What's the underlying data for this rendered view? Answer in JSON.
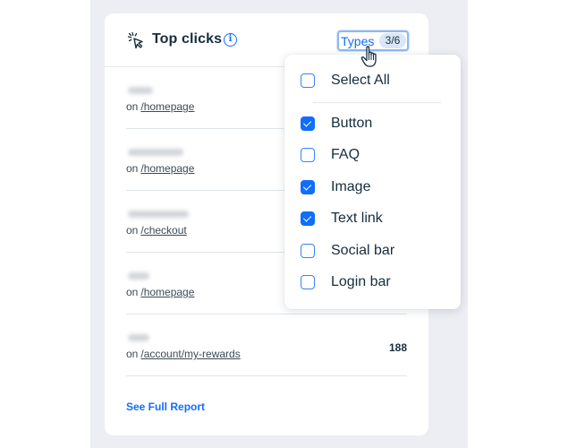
{
  "card": {
    "title": "Top clicks",
    "title_icon": "cursor-click-icon",
    "info_icon": "info-icon",
    "info_glyph": "i",
    "types_button": {
      "label": "Types",
      "count": "3/6"
    },
    "rows": [
      {
        "page_prefix": "on",
        "page": "/homepage",
        "count": ""
      },
      {
        "page_prefix": "on",
        "page": "/homepage",
        "count": ""
      },
      {
        "page_prefix": "on",
        "page": "/checkout",
        "count": ""
      },
      {
        "page_prefix": "on",
        "page": "/homepage",
        "count": ""
      },
      {
        "page_prefix": "on",
        "page": "/account/my-rewards",
        "count": "188"
      }
    ],
    "see_full_report": "See Full Report"
  },
  "types_dropdown": {
    "select_all": {
      "label": "Select All",
      "checked": false
    },
    "options": [
      {
        "label": "Button",
        "checked": true
      },
      {
        "label": "FAQ",
        "checked": false
      },
      {
        "label": "Image",
        "checked": true
      },
      {
        "label": "Text link",
        "checked": true
      },
      {
        "label": "Social bar",
        "checked": false
      },
      {
        "label": "Login bar",
        "checked": false
      }
    ]
  },
  "colors": {
    "accent": "#116dff",
    "background_panel": "#eceef3",
    "text_primary": "#162d3d"
  }
}
